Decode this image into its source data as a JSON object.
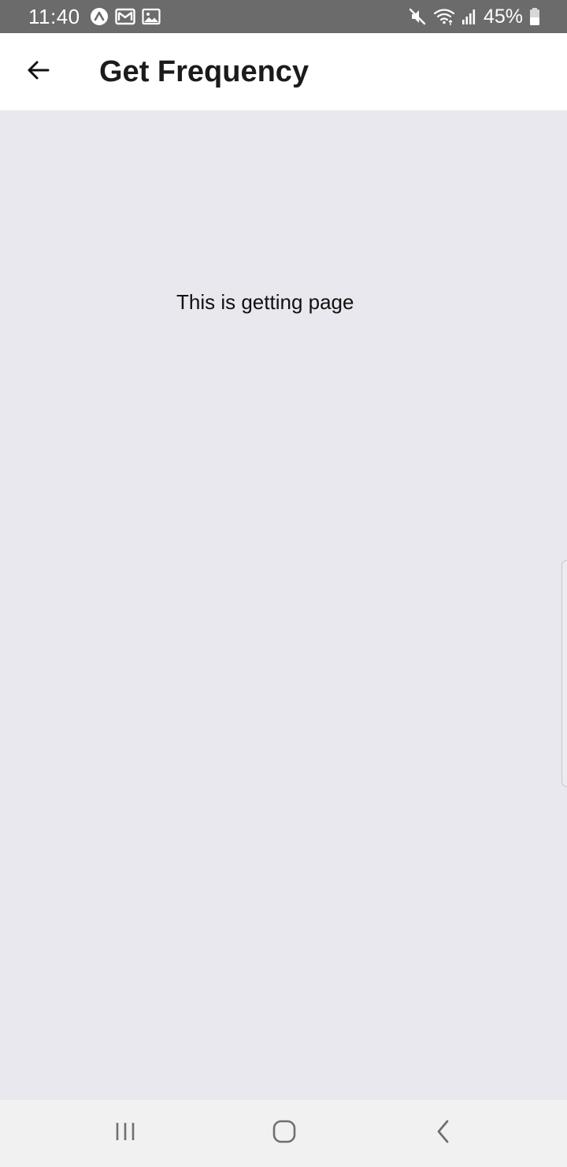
{
  "status_bar": {
    "time": "11:40",
    "battery_text": "45%",
    "left_icons": [
      "app-notification-icon",
      "gmail-icon",
      "image-icon"
    ],
    "right_icons": [
      "mute-icon",
      "wifi-icon",
      "signal-icon",
      "battery-icon"
    ]
  },
  "app_bar": {
    "title": "Get Frequency",
    "back_icon": "arrow-left-icon"
  },
  "main": {
    "message": "This is getting page"
  },
  "nav_bar": {
    "buttons": [
      "recents",
      "home",
      "back"
    ]
  },
  "colors": {
    "status_bar_bg": "#6b6b6b",
    "app_bar_bg": "#ffffff",
    "content_bg": "#e9e8ee",
    "nav_bar_bg": "#f1f1f1",
    "text_primary": "#111111"
  }
}
